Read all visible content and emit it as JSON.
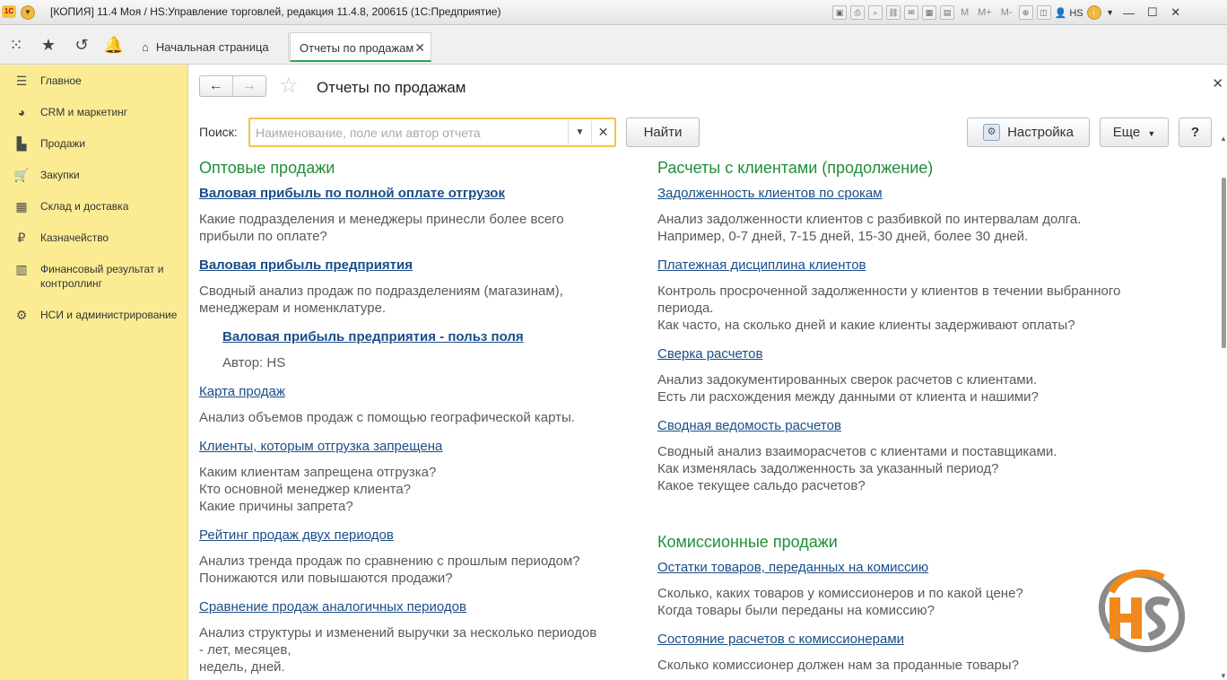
{
  "window": {
    "title": "[КОПИЯ] 11.4 Моя / HS:Управление торговлей, редакция 11.4.8, 200615  (1С:Предприятие)",
    "user": "HS",
    "toolbar_text": [
      "M",
      "M+",
      "M-"
    ]
  },
  "tabs": {
    "home": "Начальная страница",
    "reports": "Отчеты по продажам"
  },
  "sidebar": {
    "items": [
      {
        "label": "Главное"
      },
      {
        "label": "CRM и маркетинг"
      },
      {
        "label": "Продажи"
      },
      {
        "label": "Закупки"
      },
      {
        "label": "Склад и доставка"
      },
      {
        "label": "Казначейство"
      },
      {
        "label": "Финансовый результат и контроллинг"
      },
      {
        "label": "НСИ и администрирование"
      }
    ]
  },
  "form": {
    "title": "Отчеты по продажам",
    "search_label": "Поиск:",
    "search_placeholder": "Наименование, поле или автор отчета",
    "find_label": "Найти",
    "settings_label": "Настройка",
    "more_label": "Еще",
    "help_label": "?"
  },
  "left": {
    "section_title": "Оптовые продажи",
    "reports": [
      {
        "title": "Валовая прибыль по полной оплате отгрузок",
        "desc": "Какие подразделения и менеджеры принесли более всего\nприбыли по оплате?"
      },
      {
        "title": "Валовая прибыль предприятия",
        "desc": "Сводный анализ продаж по подразделениям (магазинам),\nменеджерам и номенклатуре."
      },
      {
        "title": "Валовая прибыль предприятия - польз поля",
        "desc": "Автор: HS"
      },
      {
        "title": "Карта продаж",
        "desc": "Анализ объемов продаж с помощью географической карты."
      },
      {
        "title": "Клиенты, которым отгрузка запрещена",
        "desc": "Каким клиентам запрещена отгрузка?\nКто основной менеджер клиента?\nКакие причины запрета?"
      },
      {
        "title": "Рейтинг продаж двух периодов",
        "desc": "Анализ тренда продаж по сравнению с прошлым периодом?\nПонижаются или повышаются продажи?"
      },
      {
        "title": "Сравнение продаж аналогичных периодов",
        "desc": "Анализ структуры и изменений выручки за несколько периодов\n- лет, месяцев,\nнедель, дней."
      }
    ]
  },
  "right": {
    "section_title": "Расчеты с клиентами (продолжение)",
    "reports": [
      {
        "title": "Задолженность клиентов по срокам",
        "desc": "Анализ задолженности клиентов с разбивкой по интервалам долга.\nНапример, 0-7 дней, 7-15 дней, 15-30 дней, более 30 дней."
      },
      {
        "title": "Платежная дисциплина клиентов",
        "desc": "Контроль просроченной задолженности у клиентов в течении выбранного\nпериода.\nКак часто, на сколько дней и какие клиенты задерживают оплаты?"
      },
      {
        "title": "Сверка расчетов",
        "desc": "Анализ задокументированных сверок расчетов с клиентами.\nЕсть ли расхождения между данными от клиента и нашими?"
      },
      {
        "title": "Сводная ведомость расчетов",
        "desc": "Сводный анализ взаиморасчетов с клиентами и поставщиками.\nКак изменялась задолженность за указанный период?\nКакое текущее сальдо расчетов?"
      }
    ],
    "section2_title": "Комиссионные продажи",
    "reports2": [
      {
        "title": "Остатки товаров, переданных на комиссию",
        "desc": "Сколько, каких товаров у комиссионеров и по какой цене?\nКогда товары были переданы на комиссию?"
      },
      {
        "title": "Состояние расчетов с комиссионерами",
        "desc": "Сколько комиссионер должен нам за проданные товары?"
      }
    ]
  },
  "logo": {
    "text": "HS",
    "color_primary": "#f08a1c",
    "color_secondary": "#7a7a7a"
  },
  "colors": {
    "sidebar": "#fbec93",
    "section_title": "#1f8f3a",
    "link": "#1b4d88",
    "search_border": "#f3c34a"
  }
}
